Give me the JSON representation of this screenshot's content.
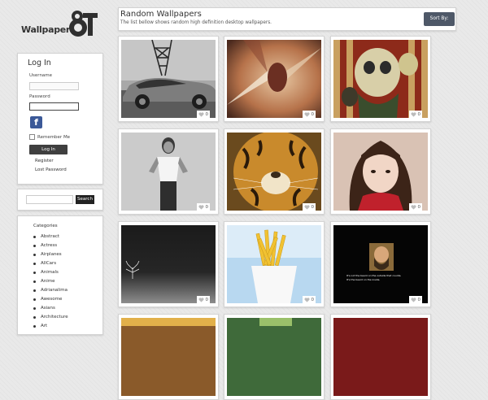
{
  "logo": {
    "text": "Wallpapers"
  },
  "login": {
    "title": "Log In",
    "username_label": "Username",
    "password_label": "Password",
    "facebook_glyph": "f",
    "remember_label": "Remember Me",
    "login_button": "Log In",
    "register_link": "Register",
    "lost_password_link": "Lost Password"
  },
  "search": {
    "button_label": "Search"
  },
  "categories": {
    "title": "Categories",
    "items": [
      "Abstract",
      "Actress",
      "Airplanes",
      "AllCars",
      "Animals",
      "Anime",
      "Adrianalima",
      "Awesome",
      "Asians",
      "Architecture",
      "Art"
    ]
  },
  "header": {
    "title": "Random Wallpapers",
    "subtitle": "The list bellow shows random high definition desktop wallpapers.",
    "sort_button": "Sort By:"
  },
  "wallpapers": [
    {
      "likes": "0",
      "icon": "car-photo"
    },
    {
      "likes": "0",
      "icon": "abstract-art"
    },
    {
      "likes": "0",
      "icon": "cartoon-art"
    },
    {
      "likes": "0",
      "icon": "woman-photo"
    },
    {
      "likes": "0",
      "icon": "tiger-photo"
    },
    {
      "likes": "0",
      "icon": "girl-photo"
    },
    {
      "likes": "0",
      "icon": "tree-photo"
    },
    {
      "likes": "0",
      "icon": "fries-photo"
    },
    {
      "likes": "0",
      "icon": "quote-poster",
      "poster_line1": "It's not the beard on the outside that counts.",
      "poster_line2": "It's the beard on the inside."
    }
  ],
  "colors": {
    "sort_button": "#4e5868",
    "facebook": "#3b5998",
    "dark_button": "#3f3f3f"
  }
}
